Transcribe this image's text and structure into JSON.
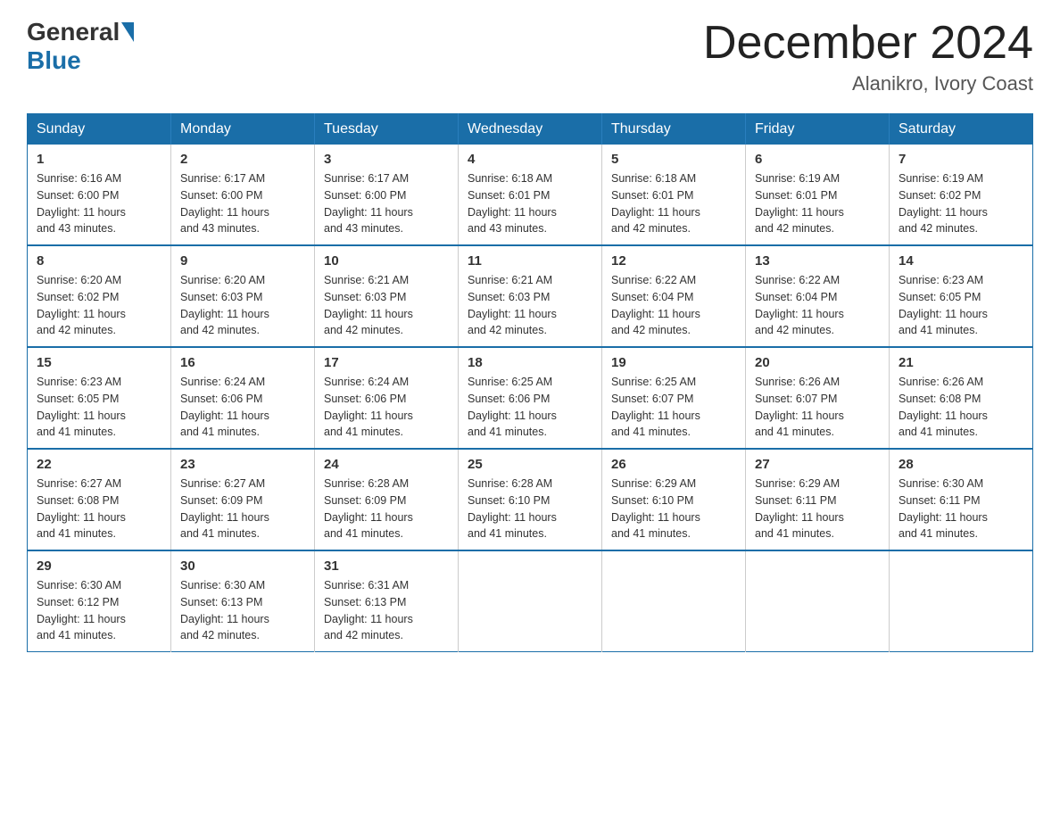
{
  "header": {
    "logo_general": "General",
    "logo_blue": "Blue",
    "month_title": "December 2024",
    "location": "Alanikro, Ivory Coast"
  },
  "days_of_week": [
    "Sunday",
    "Monday",
    "Tuesday",
    "Wednesday",
    "Thursday",
    "Friday",
    "Saturday"
  ],
  "weeks": [
    [
      {
        "day": "1",
        "sunrise": "6:16 AM",
        "sunset": "6:00 PM",
        "daylight": "11 hours and 43 minutes."
      },
      {
        "day": "2",
        "sunrise": "6:17 AM",
        "sunset": "6:00 PM",
        "daylight": "11 hours and 43 minutes."
      },
      {
        "day": "3",
        "sunrise": "6:17 AM",
        "sunset": "6:00 PM",
        "daylight": "11 hours and 43 minutes."
      },
      {
        "day": "4",
        "sunrise": "6:18 AM",
        "sunset": "6:01 PM",
        "daylight": "11 hours and 43 minutes."
      },
      {
        "day": "5",
        "sunrise": "6:18 AM",
        "sunset": "6:01 PM",
        "daylight": "11 hours and 42 minutes."
      },
      {
        "day": "6",
        "sunrise": "6:19 AM",
        "sunset": "6:01 PM",
        "daylight": "11 hours and 42 minutes."
      },
      {
        "day": "7",
        "sunrise": "6:19 AM",
        "sunset": "6:02 PM",
        "daylight": "11 hours and 42 minutes."
      }
    ],
    [
      {
        "day": "8",
        "sunrise": "6:20 AM",
        "sunset": "6:02 PM",
        "daylight": "11 hours and 42 minutes."
      },
      {
        "day": "9",
        "sunrise": "6:20 AM",
        "sunset": "6:03 PM",
        "daylight": "11 hours and 42 minutes."
      },
      {
        "day": "10",
        "sunrise": "6:21 AM",
        "sunset": "6:03 PM",
        "daylight": "11 hours and 42 minutes."
      },
      {
        "day": "11",
        "sunrise": "6:21 AM",
        "sunset": "6:03 PM",
        "daylight": "11 hours and 42 minutes."
      },
      {
        "day": "12",
        "sunrise": "6:22 AM",
        "sunset": "6:04 PM",
        "daylight": "11 hours and 42 minutes."
      },
      {
        "day": "13",
        "sunrise": "6:22 AM",
        "sunset": "6:04 PM",
        "daylight": "11 hours and 42 minutes."
      },
      {
        "day": "14",
        "sunrise": "6:23 AM",
        "sunset": "6:05 PM",
        "daylight": "11 hours and 41 minutes."
      }
    ],
    [
      {
        "day": "15",
        "sunrise": "6:23 AM",
        "sunset": "6:05 PM",
        "daylight": "11 hours and 41 minutes."
      },
      {
        "day": "16",
        "sunrise": "6:24 AM",
        "sunset": "6:06 PM",
        "daylight": "11 hours and 41 minutes."
      },
      {
        "day": "17",
        "sunrise": "6:24 AM",
        "sunset": "6:06 PM",
        "daylight": "11 hours and 41 minutes."
      },
      {
        "day": "18",
        "sunrise": "6:25 AM",
        "sunset": "6:06 PM",
        "daylight": "11 hours and 41 minutes."
      },
      {
        "day": "19",
        "sunrise": "6:25 AM",
        "sunset": "6:07 PM",
        "daylight": "11 hours and 41 minutes."
      },
      {
        "day": "20",
        "sunrise": "6:26 AM",
        "sunset": "6:07 PM",
        "daylight": "11 hours and 41 minutes."
      },
      {
        "day": "21",
        "sunrise": "6:26 AM",
        "sunset": "6:08 PM",
        "daylight": "11 hours and 41 minutes."
      }
    ],
    [
      {
        "day": "22",
        "sunrise": "6:27 AM",
        "sunset": "6:08 PM",
        "daylight": "11 hours and 41 minutes."
      },
      {
        "day": "23",
        "sunrise": "6:27 AM",
        "sunset": "6:09 PM",
        "daylight": "11 hours and 41 minutes."
      },
      {
        "day": "24",
        "sunrise": "6:28 AM",
        "sunset": "6:09 PM",
        "daylight": "11 hours and 41 minutes."
      },
      {
        "day": "25",
        "sunrise": "6:28 AM",
        "sunset": "6:10 PM",
        "daylight": "11 hours and 41 minutes."
      },
      {
        "day": "26",
        "sunrise": "6:29 AM",
        "sunset": "6:10 PM",
        "daylight": "11 hours and 41 minutes."
      },
      {
        "day": "27",
        "sunrise": "6:29 AM",
        "sunset": "6:11 PM",
        "daylight": "11 hours and 41 minutes."
      },
      {
        "day": "28",
        "sunrise": "6:30 AM",
        "sunset": "6:11 PM",
        "daylight": "11 hours and 41 minutes."
      }
    ],
    [
      {
        "day": "29",
        "sunrise": "6:30 AM",
        "sunset": "6:12 PM",
        "daylight": "11 hours and 41 minutes."
      },
      {
        "day": "30",
        "sunrise": "6:30 AM",
        "sunset": "6:13 PM",
        "daylight": "11 hours and 42 minutes."
      },
      {
        "day": "31",
        "sunrise": "6:31 AM",
        "sunset": "6:13 PM",
        "daylight": "11 hours and 42 minutes."
      },
      null,
      null,
      null,
      null
    ]
  ],
  "labels": {
    "sunrise": "Sunrise:",
    "sunset": "Sunset:",
    "daylight": "Daylight:"
  }
}
